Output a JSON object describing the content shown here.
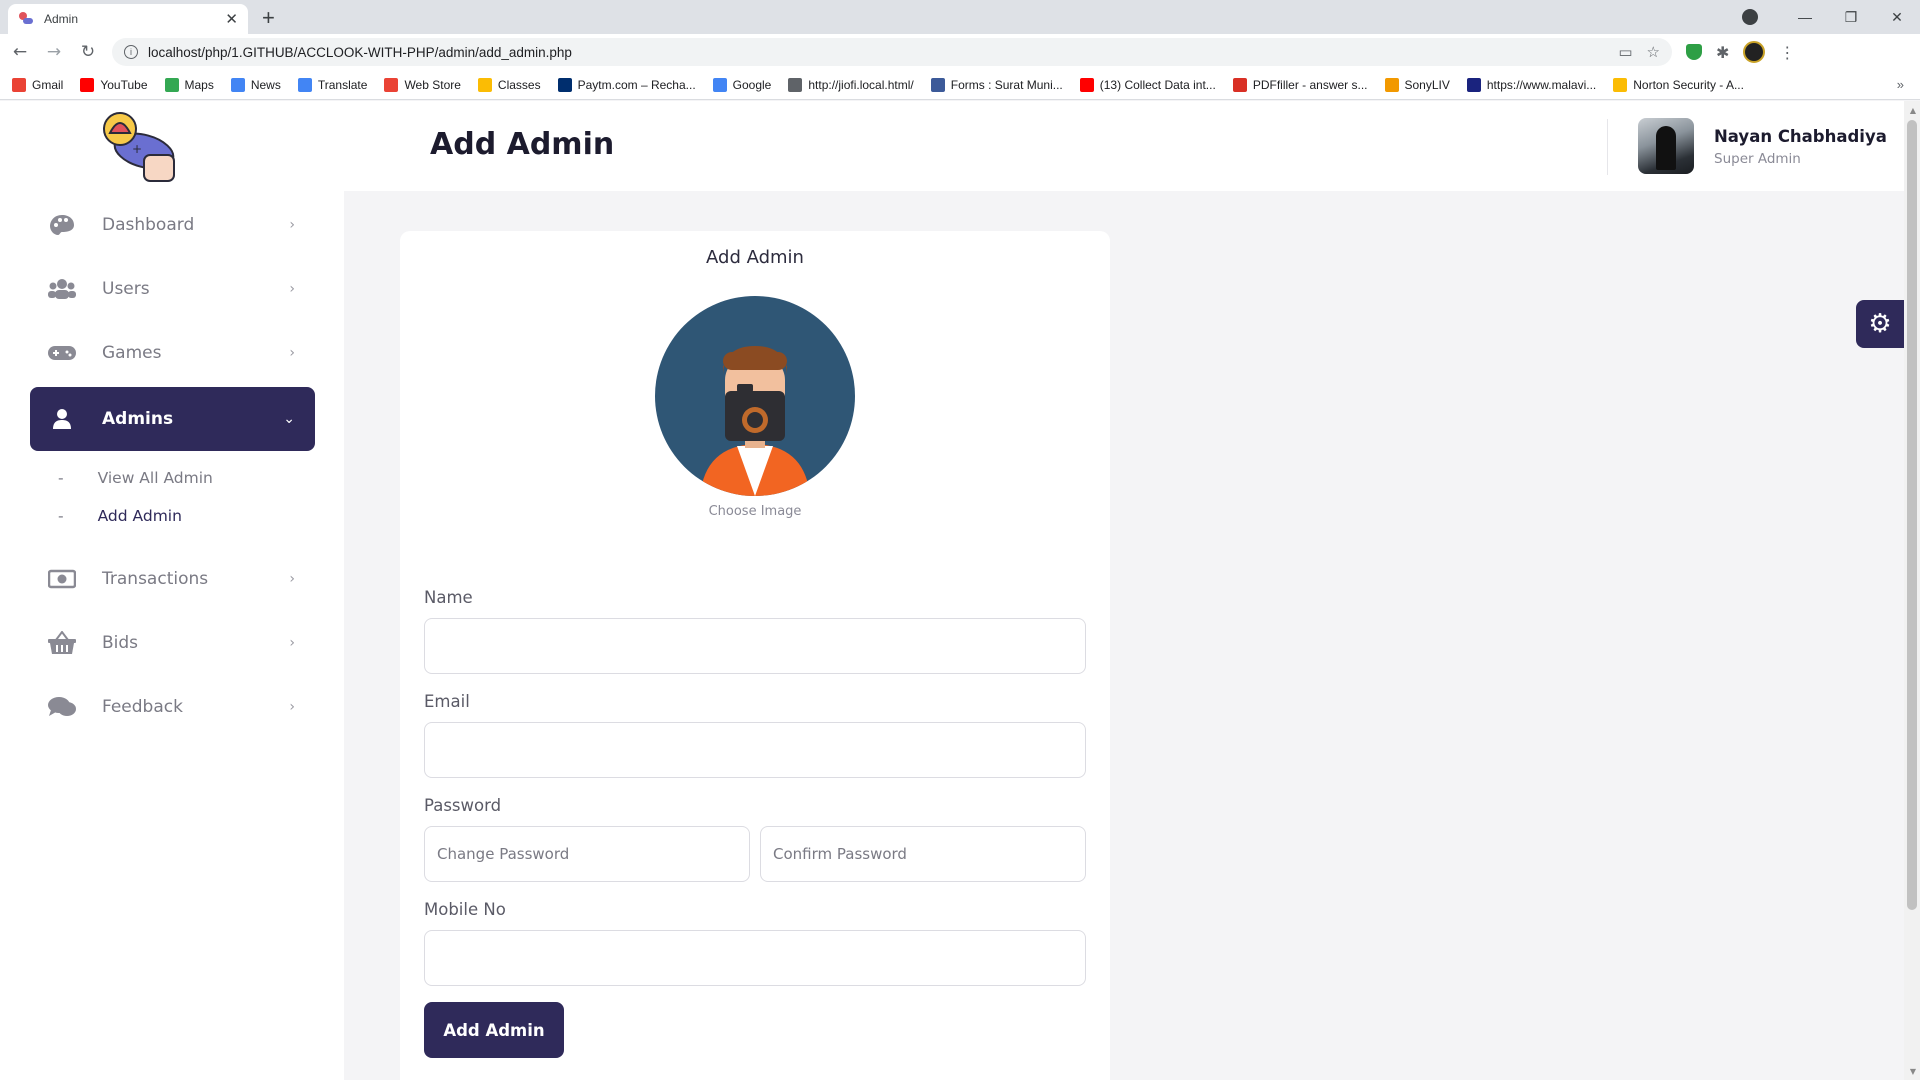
{
  "browser": {
    "tab_title": "Admin",
    "url": "localhost/php/1.GITHUB/ACCLOOK-WITH-PHP/admin/add_admin.php",
    "bookmarks": [
      {
        "label": "Gmail",
        "color": "#ea4335"
      },
      {
        "label": "YouTube",
        "color": "#ff0000"
      },
      {
        "label": "Maps",
        "color": "#34a853"
      },
      {
        "label": "News",
        "color": "#4285f4"
      },
      {
        "label": "Translate",
        "color": "#4285f4"
      },
      {
        "label": "Web Store",
        "color": "#ea4335"
      },
      {
        "label": "Classes",
        "color": "#fbbc04"
      },
      {
        "label": "Paytm.com – Recha...",
        "color": "#002e6e"
      },
      {
        "label": "Google",
        "color": "#4285f4"
      },
      {
        "label": "http://jiofi.local.html/",
        "color": "#5f6368"
      },
      {
        "label": "Forms : Surat Muni...",
        "color": "#3c5a99"
      },
      {
        "label": "(13) Collect Data int...",
        "color": "#ff0000"
      },
      {
        "label": "PDFfiller - answer s...",
        "color": "#d93025"
      },
      {
        "label": "SonyLIV",
        "color": "#f29900"
      },
      {
        "label": "https://www.malavi...",
        "color": "#1a237e"
      },
      {
        "label": "Norton Security - A...",
        "color": "#fbbc04"
      }
    ]
  },
  "sidebar": {
    "items": [
      {
        "label": "Dashboard",
        "icon": "palette-icon"
      },
      {
        "label": "Users",
        "icon": "users-icon"
      },
      {
        "label": "Games",
        "icon": "gamepad-icon"
      },
      {
        "label": "Admins",
        "icon": "user-icon",
        "active": true
      },
      {
        "label": "Transactions",
        "icon": "money-icon"
      },
      {
        "label": "Bids",
        "icon": "basket-icon"
      },
      {
        "label": "Feedback",
        "icon": "comments-icon"
      }
    ],
    "admins_submenu": [
      {
        "label": "View All Admin"
      },
      {
        "label": "Add Admin",
        "current": true
      }
    ]
  },
  "header": {
    "title": "Add Admin",
    "user_name": "Nayan Chabhadiya",
    "user_role": "Super Admin"
  },
  "form": {
    "title": "Add Admin",
    "choose_image": "Choose Image",
    "name_label": "Name",
    "email_label": "Email",
    "password_label": "Password",
    "change_password_placeholder": "Change Password",
    "confirm_password_placeholder": "Confirm Password",
    "mobile_label": "Mobile No",
    "submit_label": "Add Admin"
  },
  "colors": {
    "primary": "#2f2a5a",
    "avatar_bg": "#2f5675"
  }
}
